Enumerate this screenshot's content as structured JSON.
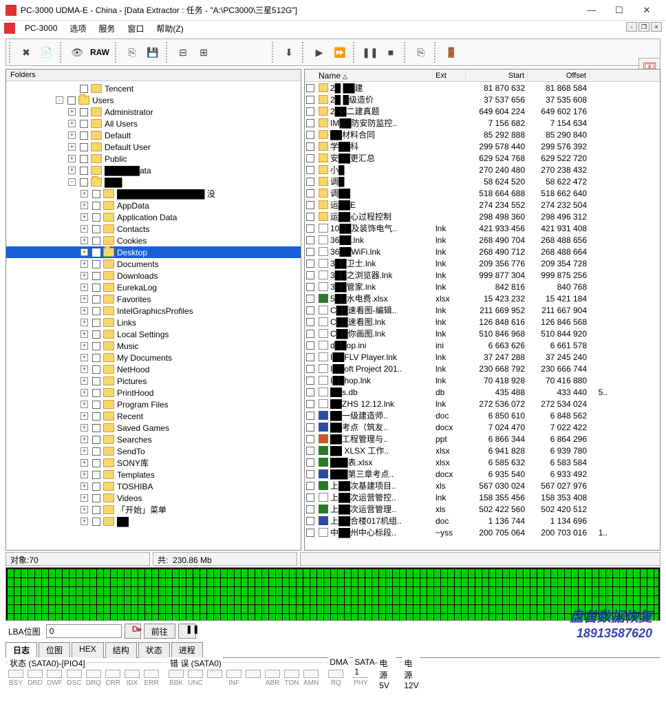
{
  "title": "PC-3000 UDMA-E - China - [Data Extractor : 任务 - \"A:\\PC3000\\三星512G\"]",
  "menubar": {
    "appLabel": "PC-3000",
    "items": [
      "选项",
      "服务",
      "窗口",
      "帮助(Z)"
    ]
  },
  "toolbar": {
    "raw": "RAW"
  },
  "leftPanel": {
    "header": "Folders"
  },
  "tree": [
    {
      "indent": 5,
      "exp": "",
      "chk": true,
      "label": "Tencent"
    },
    {
      "indent": 4,
      "exp": "-",
      "chk": true,
      "label": "Users",
      "open": true
    },
    {
      "indent": 5,
      "exp": "+",
      "chk": true,
      "label": "Administrator"
    },
    {
      "indent": 5,
      "exp": "+",
      "chk": true,
      "label": "All Users"
    },
    {
      "indent": 5,
      "exp": "+",
      "chk": true,
      "label": "Default"
    },
    {
      "indent": 5,
      "exp": "+",
      "chk": true,
      "label": "Default User"
    },
    {
      "indent": 5,
      "exp": "+",
      "chk": true,
      "label": "Public"
    },
    {
      "indent": 5,
      "exp": "+",
      "chk": true,
      "label": "██████ata",
      "censored": true
    },
    {
      "indent": 5,
      "exp": "-",
      "chk": true,
      "label": "███",
      "open": true,
      "censored": true
    },
    {
      "indent": 6,
      "exp": "+",
      "chk": true,
      "label": "███████████████ 没",
      "censored": true
    },
    {
      "indent": 6,
      "exp": "+",
      "chk": true,
      "label": "AppData"
    },
    {
      "indent": 6,
      "exp": "+",
      "chk": true,
      "label": "Application Data"
    },
    {
      "indent": 6,
      "exp": "+",
      "chk": true,
      "label": "Contacts"
    },
    {
      "indent": 6,
      "exp": "+",
      "chk": true,
      "label": "Cookies"
    },
    {
      "indent": 6,
      "exp": "+",
      "chk": true,
      "label": "Desktop",
      "selected": true,
      "open": true
    },
    {
      "indent": 6,
      "exp": "+",
      "chk": true,
      "label": "Documents"
    },
    {
      "indent": 6,
      "exp": "+",
      "chk": true,
      "label": "Downloads"
    },
    {
      "indent": 6,
      "exp": "+",
      "chk": true,
      "label": "EurekaLog"
    },
    {
      "indent": 6,
      "exp": "+",
      "chk": true,
      "label": "Favorites"
    },
    {
      "indent": 6,
      "exp": "+",
      "chk": true,
      "label": "IntelGraphicsProfiles"
    },
    {
      "indent": 6,
      "exp": "+",
      "chk": true,
      "label": "Links"
    },
    {
      "indent": 6,
      "exp": "+",
      "chk": true,
      "label": "Local Settings"
    },
    {
      "indent": 6,
      "exp": "+",
      "chk": true,
      "label": "Music"
    },
    {
      "indent": 6,
      "exp": "+",
      "chk": true,
      "label": "My Documents"
    },
    {
      "indent": 6,
      "exp": "+",
      "chk": true,
      "label": "NetHood"
    },
    {
      "indent": 6,
      "exp": "+",
      "chk": true,
      "label": "Pictures"
    },
    {
      "indent": 6,
      "exp": "+",
      "chk": true,
      "label": "PrintHood"
    },
    {
      "indent": 6,
      "exp": "+",
      "chk": true,
      "label": "Program Files"
    },
    {
      "indent": 6,
      "exp": "+",
      "chk": true,
      "label": "Recent"
    },
    {
      "indent": 6,
      "exp": "+",
      "chk": true,
      "label": "Saved Games"
    },
    {
      "indent": 6,
      "exp": "+",
      "chk": true,
      "label": "Searches"
    },
    {
      "indent": 6,
      "exp": "+",
      "chk": true,
      "label": "SendTo"
    },
    {
      "indent": 6,
      "exp": "+",
      "chk": true,
      "label": "SONY库"
    },
    {
      "indent": 6,
      "exp": "+",
      "chk": true,
      "label": "Templates"
    },
    {
      "indent": 6,
      "exp": "+",
      "chk": true,
      "label": "TOSHIBA"
    },
    {
      "indent": 6,
      "exp": "+",
      "chk": true,
      "label": "Videos"
    },
    {
      "indent": 6,
      "exp": "+",
      "chk": true,
      "label": "「开始」菜单"
    },
    {
      "indent": 6,
      "exp": "+",
      "chk": true,
      "label": "██",
      "censored": true
    }
  ],
  "listHeaders": {
    "name": "Name",
    "ext": "Ext",
    "start": "Start",
    "offset": "Offset"
  },
  "files": [
    {
      "ico": "folder",
      "name": "2█ ██建",
      "ext": "",
      "start": "81 870 632",
      "offset": "81 868 584"
    },
    {
      "ico": "folder",
      "name": "2█ █级造价",
      "ext": "",
      "start": "37 537 656",
      "offset": "37 535 608"
    },
    {
      "ico": "folder",
      "name": "2██二建真题",
      "ext": "",
      "start": "649 604 224",
      "offset": "649 602 176"
    },
    {
      "ico": "folder",
      "name": "IM██防安防监控..",
      "ext": "",
      "start": "7 156 682",
      "offset": "7 154 634"
    },
    {
      "ico": "folder",
      "name": "██材料合同",
      "ext": "",
      "start": "85 292 888",
      "offset": "85 290 840"
    },
    {
      "ico": "folder",
      "name": "学██科",
      "ext": "",
      "start": "299 578 440",
      "offset": "299 576 392"
    },
    {
      "ico": "folder",
      "name": "安██更汇总",
      "ext": "",
      "start": "629 524 768",
      "offset": "629 522 720"
    },
    {
      "ico": "folder",
      "name": "小█",
      "ext": "",
      "start": "270 240 480",
      "offset": "270 238 432"
    },
    {
      "ico": "folder",
      "name": "调█",
      "ext": "",
      "start": "58 624 520",
      "offset": "58 622 472"
    },
    {
      "ico": "folder",
      "name": "调██",
      "ext": "",
      "start": "518 664 688",
      "offset": "518 662 640"
    },
    {
      "ico": "folder",
      "name": "运██E",
      "ext": "",
      "start": "274 234 552",
      "offset": "274 232 504"
    },
    {
      "ico": "folder",
      "name": "运██心过程控制",
      "ext": "",
      "start": "298 498 360",
      "offset": "298 496 312"
    },
    {
      "ico": "lnk",
      "name": "10██及装饰电气..",
      "ext": "lnk",
      "start": "421 933 456",
      "offset": "421 931 408"
    },
    {
      "ico": "lnk",
      "name": "36██.lnk",
      "ext": "lnk",
      "start": "268 490 704",
      "offset": "268 488 656"
    },
    {
      "ico": "lnk",
      "name": "36██WiFi.lnk",
      "ext": "lnk",
      "start": "268 490 712",
      "offset": "268 488 664"
    },
    {
      "ico": "lnk",
      "name": "3██卫士.lnk",
      "ext": "lnk",
      "start": "209 356 776",
      "offset": "209 354 728"
    },
    {
      "ico": "lnk",
      "name": "3██之浏览器.lnk",
      "ext": "lnk",
      "start": "999 877 304",
      "offset": "999 875 256"
    },
    {
      "ico": "lnk",
      "name": "3██管家.lnk",
      "ext": "lnk",
      "start": "842 816",
      "offset": "840 768"
    },
    {
      "ico": "xls",
      "name": "5██水电费.xlsx",
      "ext": "xlsx",
      "start": "15 423 232",
      "offset": "15 421 184"
    },
    {
      "ico": "lnk",
      "name": "C██速看图-编辑..",
      "ext": "lnk",
      "start": "211 669 952",
      "offset": "211 667 904"
    },
    {
      "ico": "lnk",
      "name": "C██速看图.lnk",
      "ext": "lnk",
      "start": "126 848 616",
      "offset": "126 846 568"
    },
    {
      "ico": "lnk",
      "name": "C██你画图.lnk",
      "ext": "lnk",
      "start": "510 846 968",
      "offset": "510 844 920"
    },
    {
      "ico": "file",
      "name": "d██op.ini",
      "ext": "ini",
      "start": "6 663 626",
      "offset": "6 661 578"
    },
    {
      "ico": "lnk",
      "name": "I██FLV Player.lnk",
      "ext": "lnk",
      "start": "37 247 288",
      "offset": "37 245 240"
    },
    {
      "ico": "lnk",
      "name": "I██oft Project 201..",
      "ext": "lnk",
      "start": "230 668 792",
      "offset": "230 666 744"
    },
    {
      "ico": "lnk",
      "name": "I██hop.lnk",
      "ext": "lnk",
      "start": "70 418 928",
      "offset": "70 416 880"
    },
    {
      "ico": "file",
      "name": "██s.db",
      "ext": "db",
      "start": "435 488",
      "offset": "433 440",
      "extra": "5.."
    },
    {
      "ico": "lnk",
      "name": "██ZHS 12.12.lnk",
      "ext": "lnk",
      "start": "272 536 072",
      "offset": "272 534 024"
    },
    {
      "ico": "doc",
      "name": "██一级建造师..",
      "ext": "doc",
      "start": "6 850 610",
      "offset": "6 848 562"
    },
    {
      "ico": "doc",
      "name": "██考点（筑友..",
      "ext": "docx",
      "start": "7 024 470",
      "offset": "7 022 422"
    },
    {
      "ico": "ppt",
      "name": "██工程管理与..",
      "ext": "ppt",
      "start": "6 866 344",
      "offset": "6 864 296"
    },
    {
      "ico": "xls",
      "name": "██ XLSX 工作..",
      "ext": "xlsx",
      "start": "6 941 828",
      "offset": "6 939 780"
    },
    {
      "ico": "xls",
      "name": "███表.xlsx",
      "ext": "xlsx",
      "start": "6 585 632",
      "offset": "6 583 584"
    },
    {
      "ico": "doc",
      "name": "███第三章考点..",
      "ext": "docx",
      "start": "6 935 540",
      "offset": "6 933 492"
    },
    {
      "ico": "xls",
      "name": "上██次基建项目..",
      "ext": "xls",
      "start": "567 030 024",
      "offset": "567 027 976"
    },
    {
      "ico": "lnk",
      "name": "上██次运营管控..",
      "ext": "lnk",
      "start": "158 355 456",
      "offset": "158 353 408"
    },
    {
      "ico": "xls",
      "name": "上██次运营管理..",
      "ext": "xls",
      "start": "502 422 560",
      "offset": "502 420 512"
    },
    {
      "ico": "doc",
      "name": "上██合楼017机组..",
      "ext": "doc",
      "start": "1 136 744",
      "offset": "1 134 696"
    },
    {
      "ico": "file",
      "name": "中██州中心标段..",
      "ext": "~yss",
      "start": "200 705 064",
      "offset": "200 703 016",
      "extra": "1.."
    }
  ],
  "status": {
    "objects_label": "对象:",
    "objects": "70",
    "total_label": "共:",
    "total": "230.86 Mb"
  },
  "nav": {
    "lba_label": "LBA位图",
    "input": "0",
    "go": "前往"
  },
  "tabs": [
    "日志",
    "位图",
    "HEX",
    "结构",
    "状态",
    "进程"
  ],
  "bottom": {
    "g1": {
      "title": "状态 (SATA0)-[PIO4]",
      "leds": [
        "BSY",
        "DRD",
        "DWF",
        "DSC",
        "DRQ",
        "CRR",
        "IDX",
        "ERR"
      ]
    },
    "g2": {
      "title": "错 误 (SATA0)",
      "leds": [
        "BBK",
        "UNC",
        "",
        "INF",
        "",
        "ABR",
        "TON",
        "AMN"
      ]
    },
    "g3": {
      "title": "DMA",
      "leds": [
        "RQ"
      ]
    },
    "g4": {
      "title": "SATA-1",
      "leds": [
        "PHY"
      ]
    },
    "g5": {
      "title": "电源 5V",
      "leds": [
        "5V"
      ]
    },
    "g6": {
      "title": "电源 12V",
      "leds": [
        "12V"
      ]
    }
  },
  "watermark": {
    "line1": "盘首数据恢复",
    "line2": "18913587620"
  }
}
